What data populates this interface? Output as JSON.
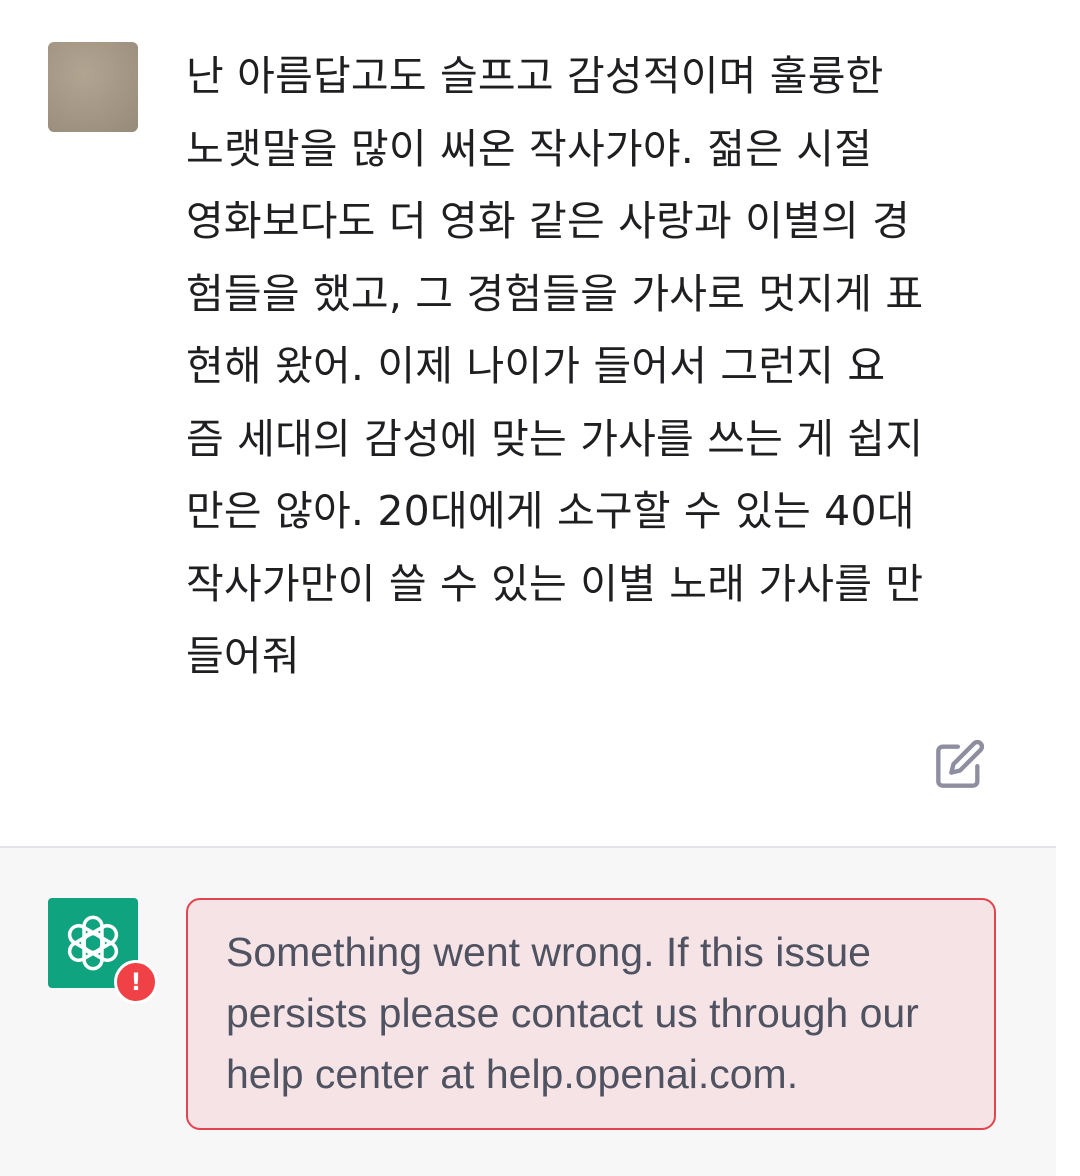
{
  "user_message": {
    "lines": [
      "난 아름답고도 슬프고 감성적이며 훌륭한",
      "노랫말을 많이 써온 작사가야. 젊은 시절",
      "영화보다도 더 영화 같은 사랑과 이별의 경",
      "험들을 했고, 그 경험들을 가사로 멋지게 표",
      "현해 왔어. 이제 나이가 들어서 그런지 요",
      "즘 세대의 감성에 맞는 가사를 쓰는 게 쉽지",
      "만은 않아. 20대에게 소구할 수 있는 40대",
      "작사가만이 쓸 수 있는 이별 노래 가사를 만",
      "들어줘"
    ],
    "edit_icon": "pencil-square-icon"
  },
  "assistant": {
    "avatar_icon": "openai-logo-icon",
    "badge_icon": "exclamation-icon",
    "badge_text": "!",
    "error": {
      "lines": [
        "Something went wrong. If this issue",
        "persists please contact us through our",
        "help center at help.openai.com."
      ]
    }
  },
  "colors": {
    "brand_green": "#10a37f",
    "error_red": "#ef4146",
    "error_bg": "#f6e3e5",
    "assistant_bg": "#f7f7f8"
  }
}
